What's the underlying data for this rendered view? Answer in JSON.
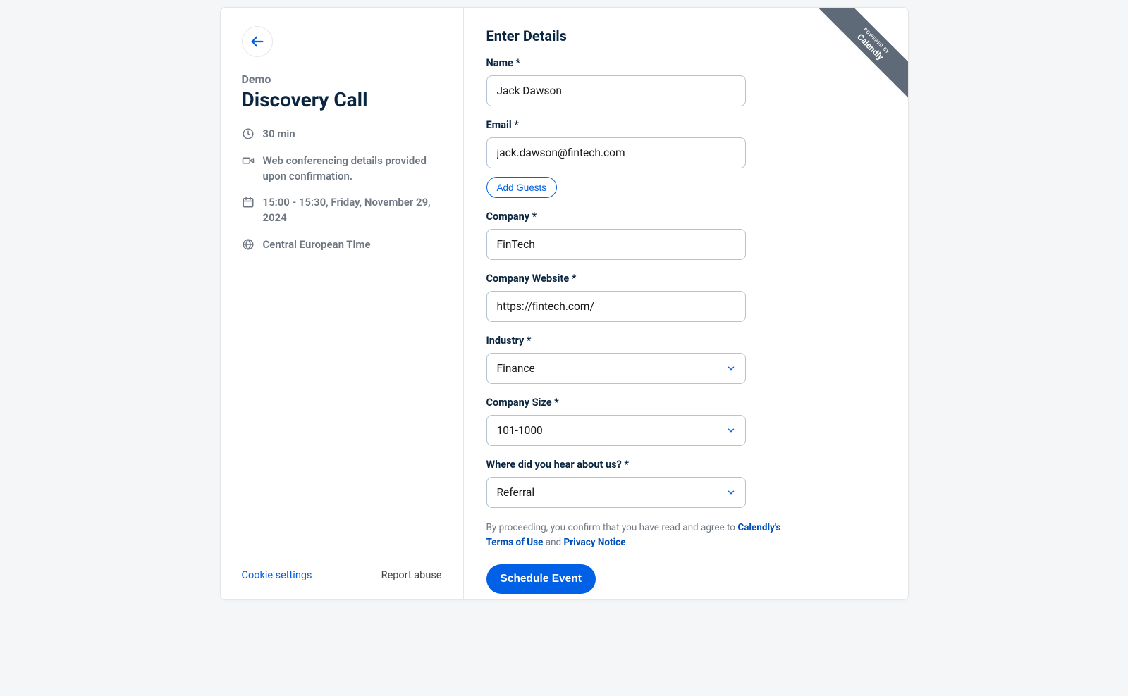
{
  "ribbon": {
    "line1": "POWERED BY",
    "line2": "Calendly"
  },
  "left": {
    "organizer": "Demo",
    "title": "Discovery Call",
    "duration": "30 min",
    "location": "Web conferencing details provided upon confirmation.",
    "datetime": "15:00 - 15:30, Friday, November 29, 2024",
    "timezone": "Central European Time",
    "cookie_settings": "Cookie settings",
    "report_abuse": "Report abuse"
  },
  "form": {
    "heading": "Enter Details",
    "name_label": "Name *",
    "name_value": "Jack Dawson",
    "email_label": "Email *",
    "email_value": "jack.dawson@fintech.com",
    "add_guests": "Add Guests",
    "company_label": "Company *",
    "company_value": "FinTech",
    "website_label": "Company Website *",
    "website_value": "https://fintech.com/",
    "industry_label": "Industry *",
    "industry_value": "Finance",
    "size_label": "Company Size *",
    "size_value": "101-1000",
    "source_label": "Where did you hear about us? *",
    "source_value": "Referral",
    "legal_prefix": "By proceeding, you confirm that you have read and agree to ",
    "legal_terms": "Calendly's Terms of Use",
    "legal_and": " and ",
    "legal_privacy": "Privacy Notice",
    "legal_suffix": ".",
    "submit": "Schedule Event"
  }
}
